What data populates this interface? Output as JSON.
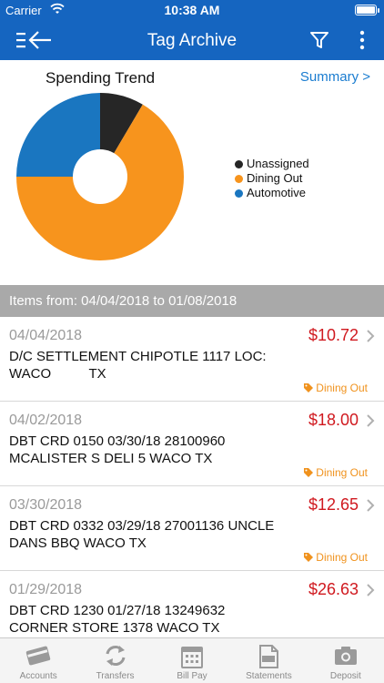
{
  "status_bar": {
    "carrier": "Carrier",
    "time": "10:38 AM"
  },
  "nav": {
    "title": "Tag Archive",
    "icons": [
      "menu-back-icon",
      "filter-icon",
      "more-vertical-icon"
    ]
  },
  "chart_section": {
    "title": "Spending Trend",
    "summary_link": "Summary >"
  },
  "chart_data": {
    "type": "pie",
    "title": "Spending Trend",
    "series": [
      {
        "name": "Unassigned",
        "value": 8.5,
        "color": "#262626"
      },
      {
        "name": "Dining Out",
        "value": 66.5,
        "color": "#f7941d"
      },
      {
        "name": "Automotive",
        "value": 25.0,
        "color": "#1a76c0"
      }
    ],
    "legend_position": "right",
    "donut": true
  },
  "range_bar": {
    "text": "Items from: 04/04/2018 to 01/08/2018"
  },
  "transactions": [
    {
      "date": "04/04/2018",
      "amount": "$10.72",
      "description": "D/C SETTLEMENT CHIPOTLE 1117 LOC:\nWACO          TX",
      "tag": "Dining Out"
    },
    {
      "date": "04/02/2018",
      "amount": "$18.00",
      "description": "DBT CRD 0150 03/30/18 28100960 MCALISTER S DELI 5 WACO TX",
      "tag": "Dining Out"
    },
    {
      "date": "03/30/2018",
      "amount": "$12.65",
      "description": "DBT CRD 0332 03/29/18 27001136 UNCLE DANS BBQ WACO TX",
      "tag": "Dining Out"
    },
    {
      "date": "01/29/2018",
      "amount": "$26.63",
      "description": "DBT CRD 1230 01/27/18 13249632 CORNER STORE 1378 WACO TX",
      "tag": ""
    }
  ],
  "tab_bar": {
    "tabs": [
      {
        "label": "Accounts",
        "icon": "accounts-icon"
      },
      {
        "label": "Transfers",
        "icon": "transfers-icon"
      },
      {
        "label": "Bill Pay",
        "icon": "bill-pay-icon"
      },
      {
        "label": "Statements",
        "icon": "statements-icon"
      },
      {
        "label": "Deposit",
        "icon": "deposit-icon"
      }
    ]
  },
  "colors": {
    "brand_blue": "#1565c0",
    "amount_red": "#d0191f",
    "tag_orange": "#f0921d",
    "link_blue": "#1a7cd0"
  }
}
